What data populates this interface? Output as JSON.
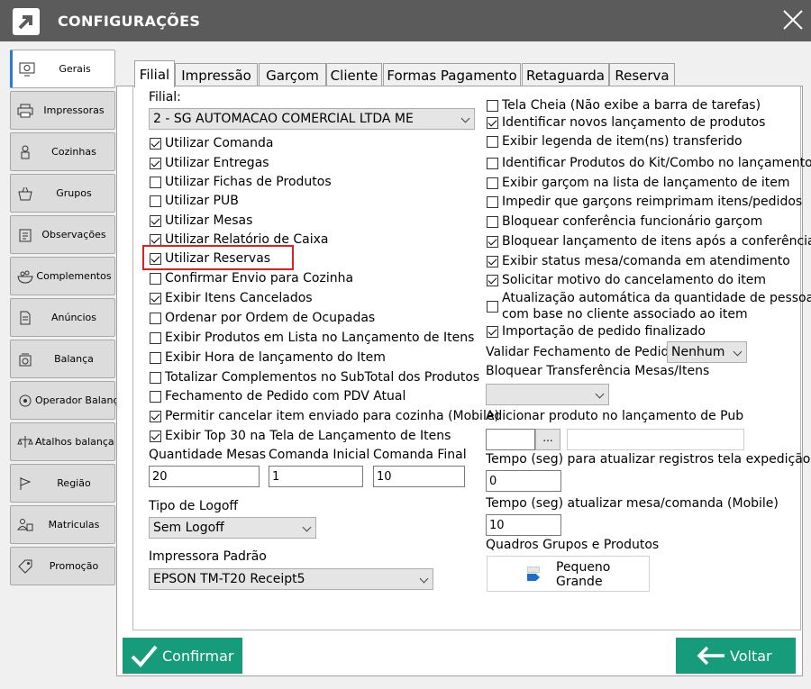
{
  "window": {
    "title": "CONFIGURAÇÕES"
  },
  "sidebar": {
    "items": [
      {
        "label": "Gerais",
        "icon": "gear-monitor-icon",
        "active": true
      },
      {
        "label": "Impressoras",
        "icon": "printer-icon"
      },
      {
        "label": "Cozinhas",
        "icon": "chef-icon"
      },
      {
        "label": "Grupos",
        "icon": "basket-icon"
      },
      {
        "label": "Observações",
        "icon": "clipboard-icon"
      },
      {
        "label": "Complementos",
        "icon": "bowl-icon"
      },
      {
        "label": "Anúncios",
        "icon": "document-icon"
      },
      {
        "label": "Balança",
        "icon": "scale-icon"
      },
      {
        "label": "Operador Balança",
        "icon": "operator-icon"
      },
      {
        "label": "Atalhos balança",
        "icon": "scale-shortcut-icon"
      },
      {
        "label": "Região",
        "icon": "flag-icon"
      },
      {
        "label": "Matriculas",
        "icon": "enrollment-icon"
      },
      {
        "label": "Promoção",
        "icon": "promo-icon"
      }
    ]
  },
  "tabs": [
    "Filial",
    "Impressão",
    "Garçom",
    "Cliente",
    "Formas Pagamento",
    "Retaguarda",
    "Reserva"
  ],
  "left": {
    "filial_label": "Filial:",
    "filial_value": "2 - SG AUTOMACAO COMERCIAL LTDA ME",
    "checks": [
      {
        "label": "Utilizar Comanda",
        "checked": true
      },
      {
        "label": "Utilizar Entregas",
        "checked": true
      },
      {
        "label": "Utilizar Fichas de Produtos",
        "checked": false
      },
      {
        "label": "Utilizar PUB",
        "checked": false
      },
      {
        "label": "Utilizar Mesas",
        "checked": true
      },
      {
        "label": "Utilizar Relatório de Caixa",
        "checked": true
      },
      {
        "label": "Utilizar Reservas",
        "checked": true
      },
      {
        "label": "Confirmar Envio para Cozinha",
        "checked": false
      },
      {
        "label": "Exibir Itens Cancelados",
        "checked": true
      },
      {
        "label": "Ordenar por Ordem de Ocupadas",
        "checked": false
      },
      {
        "label": "Exibir Produtos em Lista no Lançamento de Itens",
        "checked": false
      },
      {
        "label": "Exibir Hora de lançamento do Item",
        "checked": false
      },
      {
        "label": "Totalizar Complementos no SubTotal dos Produtos",
        "checked": false
      },
      {
        "label": "Fechamento de Pedido com PDV Atual",
        "checked": false
      },
      {
        "label": "Permitir cancelar item enviado para cozinha (Mobile)",
        "checked": true
      },
      {
        "label": "Exibir Top 30 na Tela de Lançamento de Itens",
        "checked": true
      }
    ],
    "qtd_mesas_label": "Quantidade Mesas",
    "qtd_mesas_value": "20",
    "comanda_inicial_label": "Comanda Inicial",
    "comanda_inicial_value": "1",
    "comanda_final_label": "Comanda Final",
    "comanda_final_value": "10",
    "logoff_label": "Tipo de Logoff",
    "logoff_value": "Sem Logoff",
    "impressora_label": "Impressora Padrão",
    "impressora_value": "EPSON TM-T20 Receipt5"
  },
  "right": {
    "checks": [
      {
        "label": "Tela Cheia (Não exibe a barra de tarefas)",
        "checked": false
      },
      {
        "label": "Identificar novos lançamento de produtos",
        "checked": true
      },
      {
        "label": "Exibir legenda de item(ns) transferido",
        "checked": false
      },
      {
        "label": "Identificar Produtos do Kit/Combo no lançamento",
        "checked": false
      },
      {
        "label": "Exibir garçom na lista de lançamento de item",
        "checked": false
      },
      {
        "label": "Impedir que garçons reimprimam itens/pedidos",
        "checked": false
      },
      {
        "label": "Bloquear conferência funcionário garçom",
        "checked": false
      },
      {
        "label": "Bloquear lançamento de itens após a conferência",
        "checked": true
      },
      {
        "label": "Exibir status mesa/comanda em atendimento",
        "checked": true
      },
      {
        "label": "Solicitar motivo do cancelamento do item",
        "checked": true
      },
      {
        "label": "Atualização automática da quantidade de pessoas com base no cliente associado ao item",
        "line1": "Atualização automática da quantidade de pessoas",
        "line2": "com base no cliente associado ao item",
        "checked": false
      },
      {
        "label": "Importação de pedido finalizado",
        "checked": true
      }
    ],
    "validar_label": "Validar Fechamento de Pedido",
    "validar_value": "Nenhum",
    "bloquear_label": "Bloquear Transferência Mesas/Itens",
    "bloquear_value": "",
    "adicionar_label": "Adicionar produto no lançamento de Pub",
    "adicionar_value": "",
    "adicionar_btn": "...",
    "adicionar_desc": "",
    "tempo_exp_label": "Tempo (seg) para atualizar registros tela expedição",
    "tempo_exp_value": "0",
    "tempo_mob_label": "Tempo (seg) atualizar mesa/comanda (Mobile)",
    "tempo_mob_value": "10",
    "quadros_label": "Quadros Grupos e Produtos",
    "quadros_opt1": "Pequeno",
    "quadros_opt2": "Grande"
  },
  "buttons": {
    "confirmar": "Confirmar",
    "voltar": "Voltar"
  },
  "colors": {
    "titlebar": "#5b5b5b",
    "accent_green": "#169b7b",
    "highlight": "#e02020"
  }
}
